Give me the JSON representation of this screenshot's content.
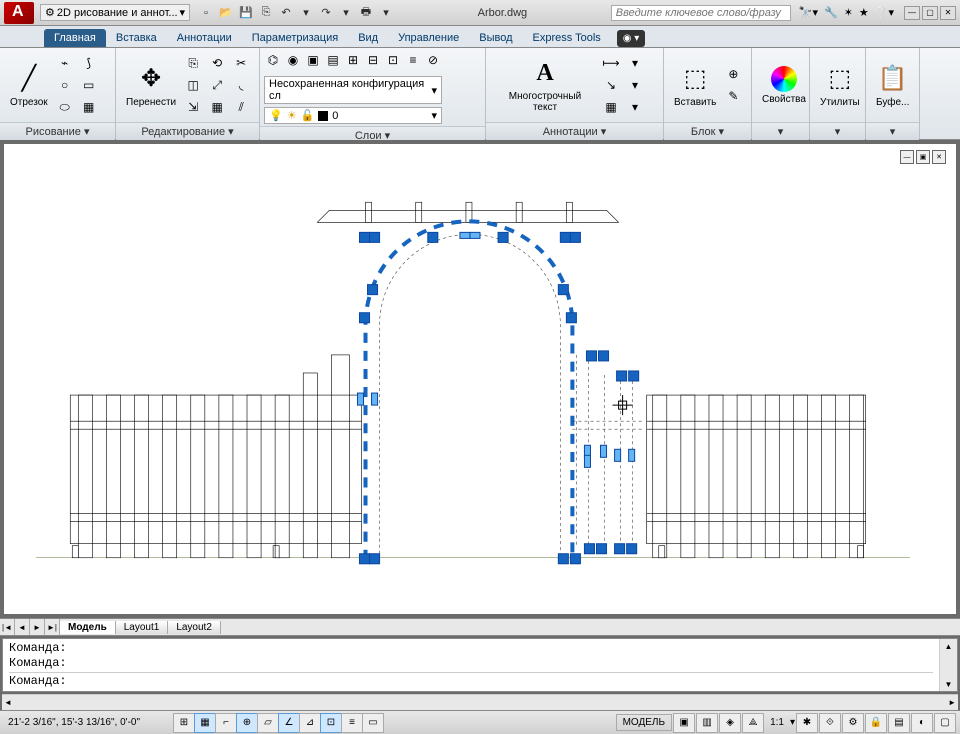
{
  "titlebar": {
    "workspace": "2D рисование и аннот...",
    "filename": "Arbor.dwg",
    "search_placeholder": "Введите ключевое слово/фразу"
  },
  "tabs": {
    "items": [
      "Главная",
      "Вставка",
      "Аннотации",
      "Параметризация",
      "Вид",
      "Управление",
      "Вывод",
      "Express Tools"
    ],
    "active": 0
  },
  "ribbon": {
    "draw": {
      "label": "Отрезок",
      "panel_title": "Рисование ▾"
    },
    "modify": {
      "label": "Перенести",
      "panel_title": "Редактирование ▾"
    },
    "layers": {
      "combo": "Несохраненная конфигурация сл",
      "name": "0",
      "panel_title": "Слои ▾"
    },
    "annot": {
      "label": "Многострочный текст",
      "panel_title": "Аннотации ▾"
    },
    "block": {
      "label": "Вставить",
      "panel_title": "Блок ▾"
    },
    "props": {
      "label": "Свойства"
    },
    "utils": {
      "label": "Утилиты"
    },
    "clip": {
      "label": "Буфе..."
    }
  },
  "layout_tabs": {
    "items": [
      "Модель",
      "Layout1",
      "Layout2"
    ],
    "active": 0
  },
  "command": {
    "lines": [
      "Команда:",
      "Команда:",
      "Команда:"
    ]
  },
  "status": {
    "coords": "21'-2 3/16\", 15'-3 13/16\", 0'-0\"",
    "model": "МОДЕЛЬ",
    "scale": "1:1"
  }
}
